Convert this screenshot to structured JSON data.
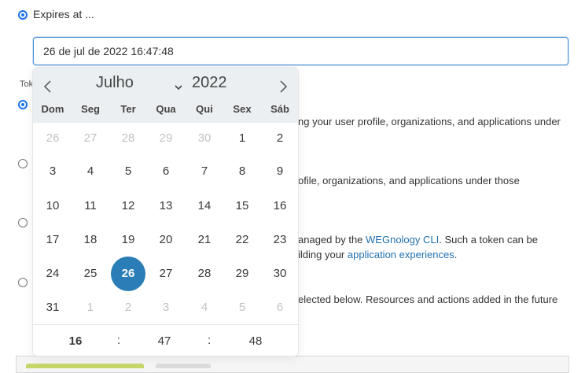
{
  "expires": {
    "label": "Expires at ...",
    "value": "26 de jul de 2022 16:47:48"
  },
  "token_label": "Tok",
  "background_lines": [
    {
      "text": "ng your user profile, organizations, and applications under"
    },
    {
      "text": "ofile, organizations, and applications under those"
    },
    {
      "prefix": "anaged by the ",
      "link": "WEGnology CLI",
      "suffix": ". Such a token can be"
    },
    {
      "prefix": "ilding your ",
      "link": "application experiences",
      "suffix": "."
    },
    {
      "text": "elected below. Resources and actions added in the future"
    }
  ],
  "calendar": {
    "month": "Julho",
    "year": "2022",
    "weekdays": [
      "Dom",
      "Seg",
      "Ter",
      "Qua",
      "Qui",
      "Sex",
      "Sáb"
    ],
    "days": [
      [
        "26",
        "27",
        "28",
        "29",
        "30",
        "1",
        "2"
      ],
      [
        "3",
        "4",
        "5",
        "6",
        "7",
        "8",
        "9"
      ],
      [
        "10",
        "11",
        "12",
        "13",
        "14",
        "15",
        "16"
      ],
      [
        "17",
        "18",
        "19",
        "20",
        "21",
        "22",
        "23"
      ],
      [
        "24",
        "25",
        "26",
        "27",
        "28",
        "29",
        "30"
      ],
      [
        "31",
        "1",
        "2",
        "3",
        "4",
        "5",
        "6"
      ]
    ],
    "selected_day": "26",
    "time": {
      "hour": "16",
      "minute": "47",
      "second": "48",
      "separator": ":"
    }
  },
  "colors": {
    "accent": "#2a7db7",
    "header_bg": "#eceff1",
    "link": "#1f6fae"
  }
}
